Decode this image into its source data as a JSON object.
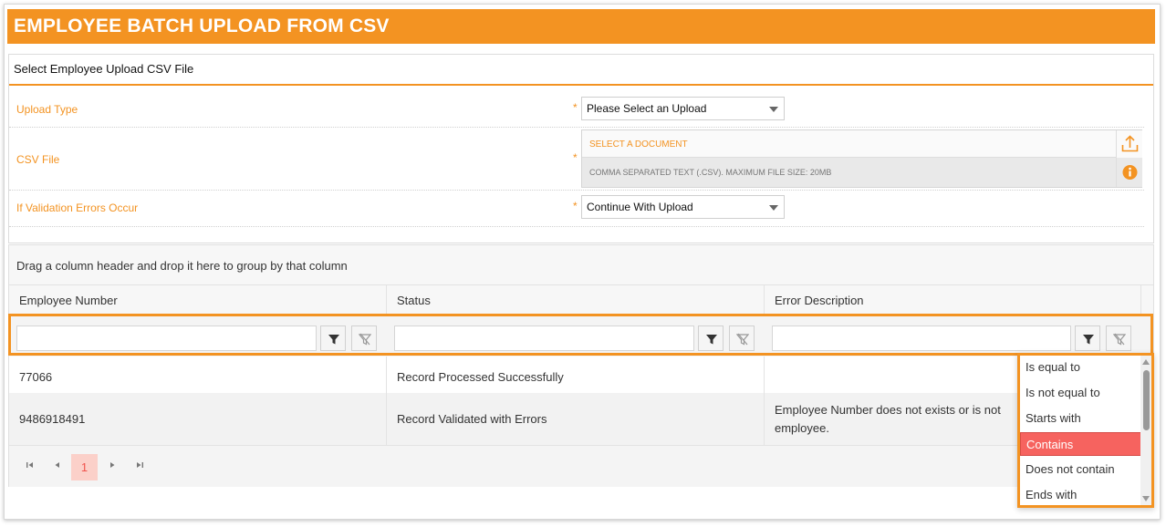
{
  "header": {
    "title": "EMPLOYEE BATCH UPLOAD FROM CSV"
  },
  "form": {
    "panel_title": "Select Employee Upload CSV File",
    "required_mark": "*",
    "upload_type": {
      "label": "Upload Type",
      "value": "Please Select an Upload"
    },
    "csv_file": {
      "label": "CSV File",
      "select_text": "SELECT A DOCUMENT",
      "hint": "COMMA SEPARATED TEXT (.CSV). MAXIMUM FILE SIZE: 20MB"
    },
    "validation": {
      "label": "If Validation Errors Occur",
      "value": "Continue With Upload"
    }
  },
  "grid": {
    "group_hint": "Drag a column header and drop it here to group by that column",
    "columns": [
      "Employee Number",
      "Status",
      "Error Description"
    ],
    "rows": [
      {
        "employee_number": "77066",
        "status": "Record Processed Successfully",
        "error": ""
      },
      {
        "employee_number": "9486918491",
        "status": "Record Validated with Errors",
        "error": "Employee Number does not exists or is not",
        "error_line2": "employee."
      }
    ],
    "pager": {
      "current_page": "1"
    }
  },
  "filter_menu": {
    "options": [
      "Is equal to",
      "Is not equal to",
      "Starts with",
      "Contains",
      "Does not contain",
      "Ends with"
    ],
    "selected": "Contains"
  },
  "colors": {
    "accent": "#f39322",
    "selected_option": "#f6635f"
  }
}
